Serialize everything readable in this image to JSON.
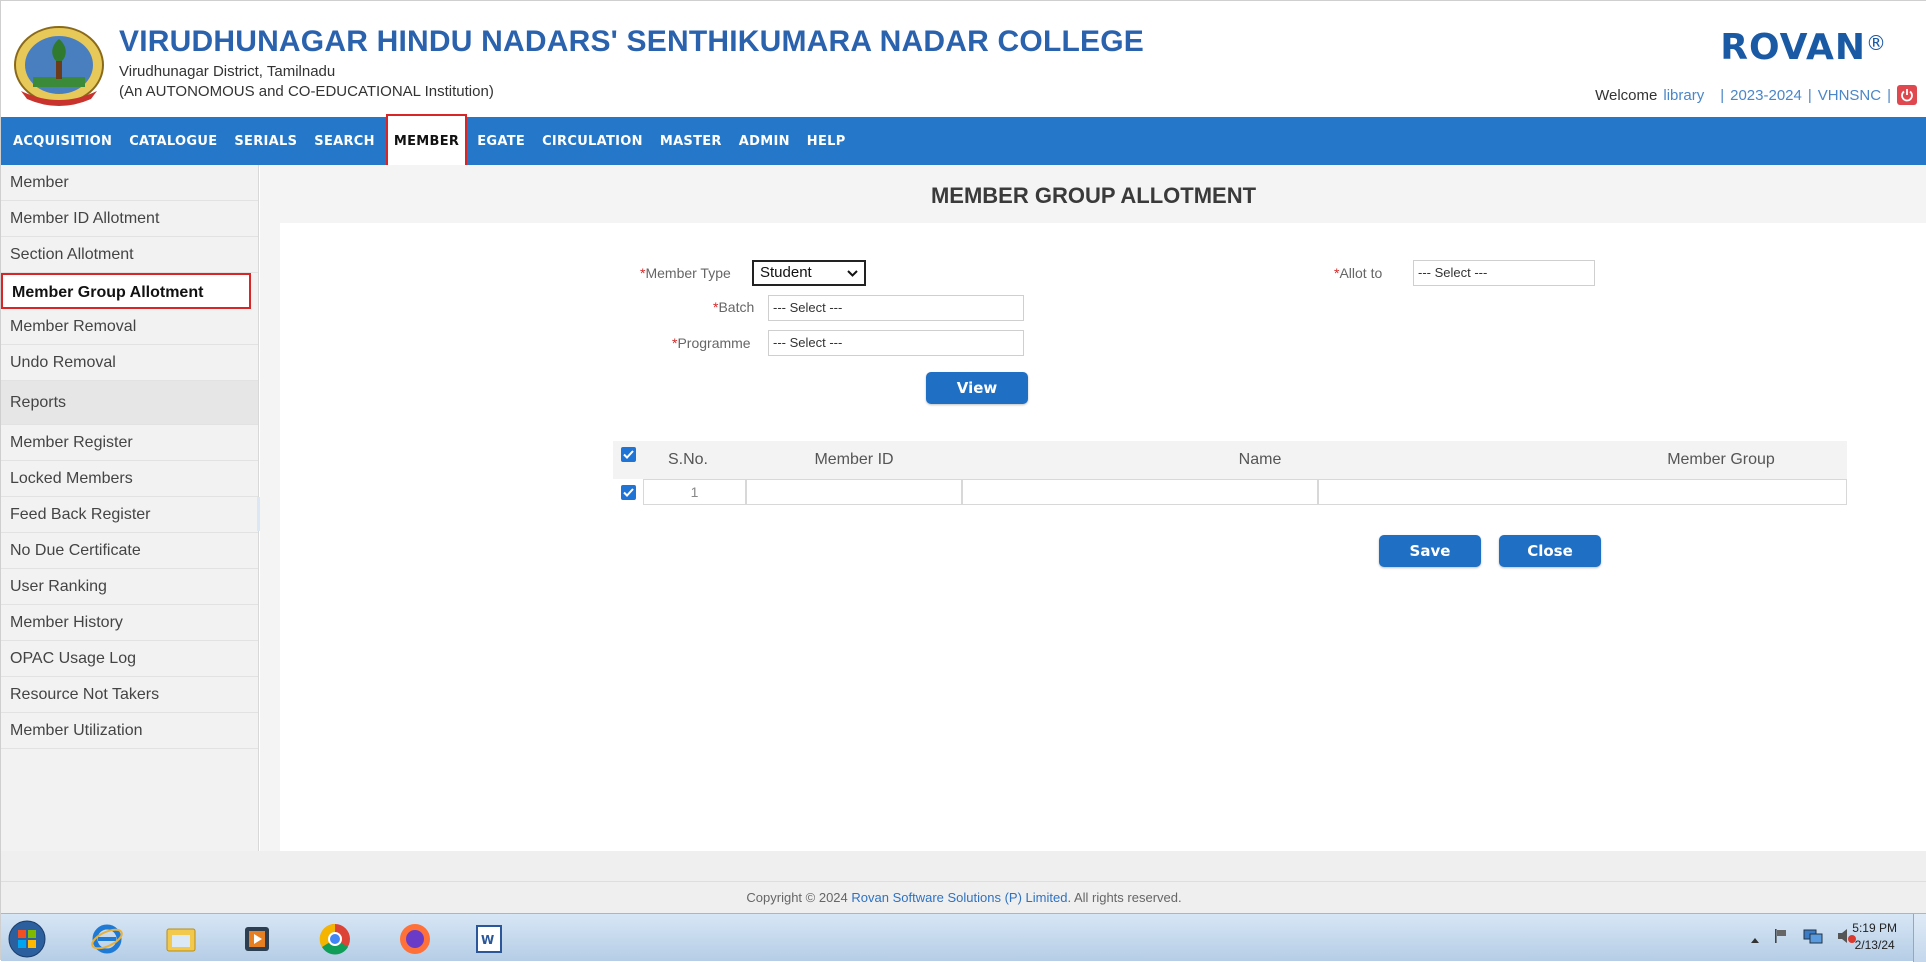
{
  "header": {
    "college_name": "VIRUDHUNAGAR HINDU NADARS' SENTHIKUMARA NADAR COLLEGE",
    "district": "Virudhunagar District, Tamilnadu",
    "institution_note": "(An AUTONOMOUS and CO-EDUCATIONAL Institution)",
    "brand": "ROVAN",
    "brand_mark": "®",
    "welcome_label": "Welcome",
    "user": "library",
    "separator": "|",
    "academic_year": "2023-2024",
    "institution_code": "VHNSNC",
    "logout_icon": "power-icon"
  },
  "navbar": {
    "items": [
      "ACQUISITION",
      "CATALOGUE",
      "SERIALS",
      "SEARCH",
      "MEMBER",
      "EGATE",
      "CIRCULATION",
      "MASTER",
      "ADMIN",
      "HELP"
    ],
    "active": "MEMBER"
  },
  "sidebar": {
    "items": [
      {
        "label": "Member"
      },
      {
        "label": "Member ID Allotment"
      },
      {
        "label": "Section Allotment"
      },
      {
        "label": "Member Group Allotment",
        "active": true
      },
      {
        "label": "Member Removal"
      },
      {
        "label": "Undo Removal"
      },
      {
        "label": "Reports",
        "heading": true
      },
      {
        "label": "Member Register"
      },
      {
        "label": "Locked Members"
      },
      {
        "label": "Feed Back Register"
      },
      {
        "label": "No Due Certificate"
      },
      {
        "label": "User Ranking"
      },
      {
        "label": "Member History"
      },
      {
        "label": "OPAC Usage Log"
      },
      {
        "label": "Resource Not Takers"
      },
      {
        "label": "Member Utilization"
      }
    ]
  },
  "main": {
    "title": "MEMBER GROUP ALLOTMENT",
    "required_mark": "*",
    "form": {
      "member_type_label": "Member Type",
      "member_type_value": "Student",
      "batch_label": "Batch",
      "batch_value": "--- Select ---",
      "programme_label": "Programme",
      "programme_value": "--- Select ---",
      "allot_to_label": "Allot to",
      "allot_to_value": "--- Select ---",
      "view_button": "View"
    },
    "table": {
      "columns": [
        "S.No.",
        "Member ID",
        "Name",
        "Member Group"
      ],
      "rows": [
        {
          "sno": "1",
          "member_id": "",
          "name": "",
          "member_group": "",
          "checked": true
        }
      ],
      "header_checked": true
    },
    "save_button": "Save",
    "close_button": "Close"
  },
  "footer": {
    "prefix": "Copyright © 2024",
    "company": "Rovan Software Solutions (P) Limited",
    "suffix": ". All rights reserved."
  },
  "taskbar": {
    "time": "5:19 PM",
    "date": "2/13/24",
    "apps": [
      "start-orb",
      "internet-explorer",
      "file-explorer",
      "media-player",
      "chrome",
      "firefox",
      "word"
    ]
  },
  "colors": {
    "navbar": "#2578c9",
    "title_blue": "#2b62ad",
    "button_blue": "#1f6fc4",
    "highlight_red": "#d82525"
  }
}
